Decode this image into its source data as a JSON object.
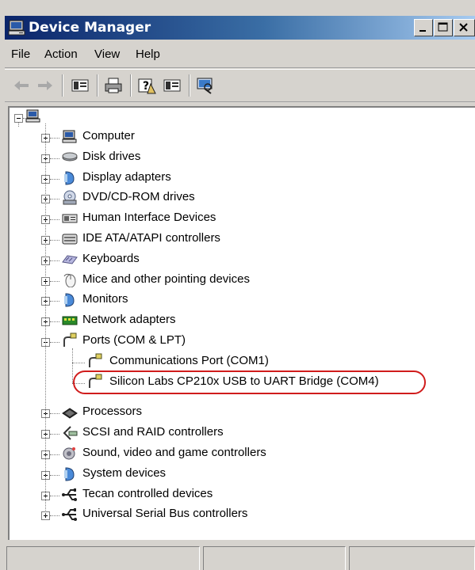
{
  "window": {
    "title": "Device Manager"
  },
  "menu": {
    "items": [
      "File",
      "Action",
      "View",
      "Help"
    ]
  },
  "toolbar": {
    "icons": [
      "back-arrow-icon",
      "forward-arrow-icon",
      "properties-icon",
      "print-icon",
      "help-icon",
      "console-tree-icon",
      "scan-hardware-icon"
    ]
  },
  "tree": {
    "root_icon": "computer-icon",
    "categories": [
      {
        "label": "Computer",
        "icon": "computer-icon",
        "expanded": false
      },
      {
        "label": "Disk drives",
        "icon": "disk-drive-icon",
        "expanded": false
      },
      {
        "label": "Display adapters",
        "icon": "display-adapter-icon",
        "expanded": false
      },
      {
        "label": "DVD/CD-ROM drives",
        "icon": "cdrom-icon",
        "expanded": false
      },
      {
        "label": "Human Interface Devices",
        "icon": "hid-icon",
        "expanded": false
      },
      {
        "label": "IDE ATA/ATAPI controllers",
        "icon": "ide-controller-icon",
        "expanded": false
      },
      {
        "label": "Keyboards",
        "icon": "keyboard-icon",
        "expanded": false
      },
      {
        "label": "Mice and other pointing devices",
        "icon": "mouse-icon",
        "expanded": false
      },
      {
        "label": "Monitors",
        "icon": "monitor-icon",
        "expanded": false
      },
      {
        "label": "Network adapters",
        "icon": "network-adapter-icon",
        "expanded": false
      },
      {
        "label": "Ports (COM & LPT)",
        "icon": "port-icon",
        "expanded": true,
        "children": [
          {
            "label": "Communications Port (COM1)",
            "icon": "port-icon",
            "highlighted": false
          },
          {
            "label": "Silicon Labs CP210x USB to UART Bridge (COM4)",
            "icon": "port-icon",
            "highlighted": true
          }
        ]
      },
      {
        "label": "Processors",
        "icon": "processor-icon",
        "expanded": false
      },
      {
        "label": "SCSI and RAID controllers",
        "icon": "scsi-icon",
        "expanded": false
      },
      {
        "label": "Sound, video and game controllers",
        "icon": "sound-icon",
        "expanded": false
      },
      {
        "label": "System devices",
        "icon": "system-devices-icon",
        "expanded": false
      },
      {
        "label": "Tecan controlled devices",
        "icon": "usb-icon",
        "expanded": false
      },
      {
        "label": "Universal Serial Bus controllers",
        "icon": "usb-icon",
        "expanded": false
      }
    ]
  },
  "colors": {
    "titlebar_start": "#0a246a",
    "titlebar_end": "#a6caf0",
    "highlight_ring": "#d01c1c"
  }
}
